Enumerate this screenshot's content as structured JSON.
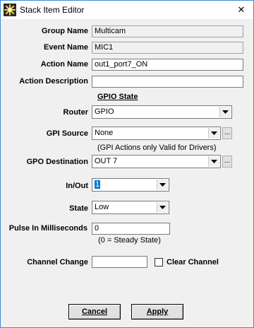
{
  "window": {
    "title": "Stack Item Editor",
    "close_glyph": "✕"
  },
  "fields": {
    "group_name": {
      "label": "Group Name",
      "value": "Multicam"
    },
    "event_name": {
      "label": "Event Name",
      "value": "MIC1"
    },
    "action_name": {
      "label": "Action Name",
      "value": "out1_port7_ON"
    },
    "action_description": {
      "label": "Action Description",
      "value": ""
    }
  },
  "gpio": {
    "section_title": "GPIO State",
    "router": {
      "label": "Router",
      "value": "GPIO"
    },
    "gpi_source": {
      "label": "GPI Source",
      "value": "None",
      "ellipsis": "..."
    },
    "gpi_note": "(GPI Actions only Valid for Drivers)",
    "gpo_destination": {
      "label": "GPO Destination",
      "value": "OUT 7",
      "ellipsis": "..."
    },
    "in_out": {
      "label": "In/Out",
      "value": "1"
    },
    "state": {
      "label": "State",
      "value": "Low"
    },
    "pulse": {
      "label": "Pulse In Milliseconds",
      "value": "0",
      "note": "(0 = Steady State)"
    }
  },
  "channel": {
    "label": "Channel Change",
    "value": "",
    "clear_label": "Clear Channel",
    "clear_checked": false
  },
  "buttons": {
    "cancel": "Cancel",
    "apply": "Apply"
  },
  "icons": {
    "app": "asterisk-app-icon",
    "dropdown": "chevron-down-icon",
    "close": "close-icon"
  }
}
